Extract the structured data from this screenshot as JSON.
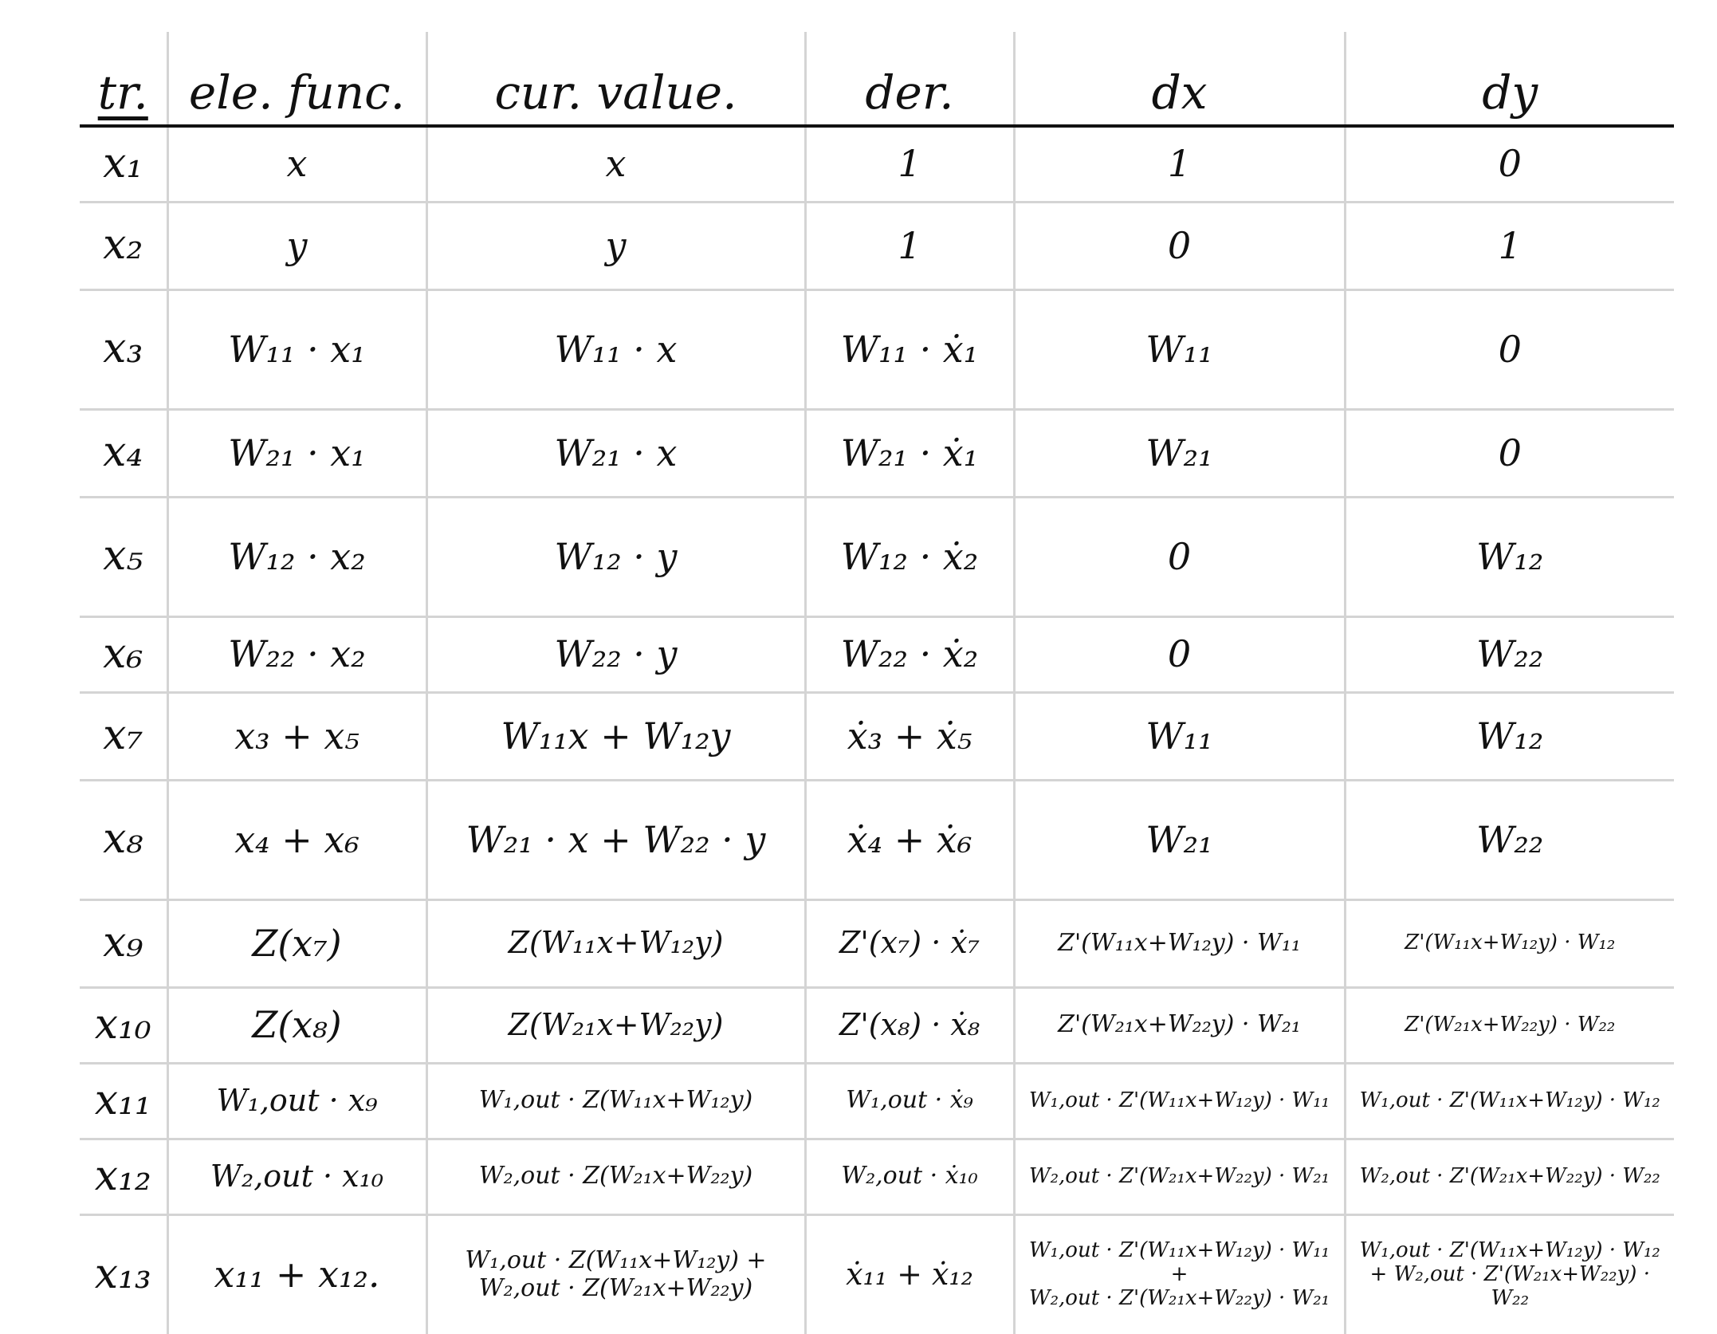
{
  "headers": [
    "tr.",
    "ele. func.",
    "cur. value.",
    "der.",
    "dx",
    "dy"
  ],
  "rows": [
    [
      "x₁",
      "x",
      "x",
      "1",
      "1",
      "0"
    ],
    [
      "x₂",
      "y",
      "y",
      "1",
      "0",
      "1"
    ],
    [
      "x₃",
      "W₁₁ · x₁",
      "W₁₁ · x",
      "W₁₁ · ẋ₁",
      "W₁₁",
      "0"
    ],
    [
      "x₄",
      "W₂₁ · x₁",
      "W₂₁ · x",
      "W₂₁ · ẋ₁",
      "W₂₁",
      "0"
    ],
    [
      "x₅",
      "W₁₂ · x₂",
      "W₁₂ · y",
      "W₁₂ · ẋ₂",
      "0",
      "W₁₂"
    ],
    [
      "x₆",
      "W₂₂ · x₂",
      "W₂₂ · y",
      "W₂₂ · ẋ₂",
      "0",
      "W₂₂"
    ],
    [
      "x₇",
      "x₃ + x₅",
      "W₁₁x + W₁₂y",
      "ẋ₃ + ẋ₅",
      "W₁₁",
      "W₁₂"
    ],
    [
      "x₈",
      "x₄ + x₆",
      "W₂₁ · x + W₂₂ · y",
      "ẋ₄ + ẋ₆",
      "W₂₁",
      "W₂₂"
    ],
    [
      "x₉",
      "Z(x₇)",
      "Z(W₁₁x+W₁₂y)",
      "Z'(x₇) · ẋ₇",
      "Z'(W₁₁x+W₁₂y) · W₁₁",
      "Z'(W₁₁x+W₁₂y) · W₁₂"
    ],
    [
      "x₁₀",
      "Z(x₈)",
      "Z(W₂₁x+W₂₂y)",
      "Z'(x₈) · ẋ₈",
      "Z'(W₂₁x+W₂₂y) · W₂₁",
      "Z'(W₂₁x+W₂₂y) · W₂₂"
    ],
    [
      "x₁₁",
      "W₁,out · x₉",
      "W₁,out · Z(W₁₁x+W₁₂y)",
      "W₁,out · ẋ₉",
      "W₁,out · Z'(W₁₁x+W₁₂y) · W₁₁",
      "W₁,out · Z'(W₁₁x+W₁₂y) · W₁₂"
    ],
    [
      "x₁₂",
      "W₂,out · x₁₀",
      "W₂,out · Z(W₂₁x+W₂₂y)",
      "W₂,out · ẋ₁₀",
      "W₂,out · Z'(W₂₁x+W₂₂y) · W₂₁",
      "W₂,out · Z'(W₂₁x+W₂₂y) · W₂₂"
    ],
    [
      "x₁₃",
      "x₁₁ + x₁₂.",
      [
        "W₁,out · Z(W₁₁x+W₁₂y) +",
        "W₂,out · Z(W₂₁x+W₂₂y)"
      ],
      "ẋ₁₁ + ẋ₁₂",
      [
        "W₁,out · Z'(W₁₁x+W₁₂y) · W₁₁ +",
        "W₂,out · Z'(W₂₁x+W₂₂y) · W₂₁"
      ],
      [
        "W₁,out · Z'(W₁₁x+W₁₂y) · W₁₂",
        "+ W₂,out · Z'(W₂₁x+W₂₂y) · W₂₂"
      ]
    ]
  ]
}
